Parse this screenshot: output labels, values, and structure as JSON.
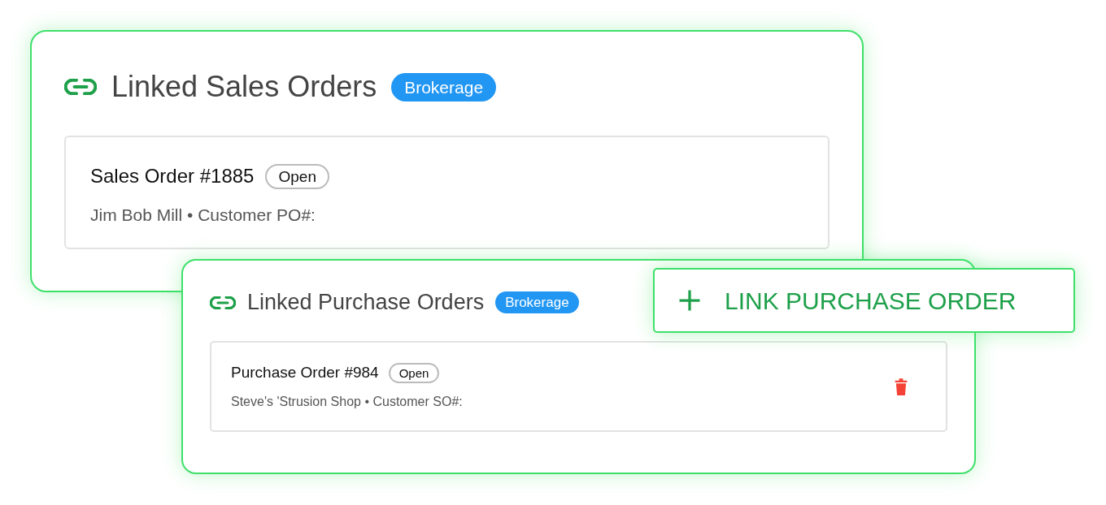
{
  "sales_panel": {
    "title": "Linked Sales Orders",
    "badge": "Brokerage",
    "orders": [
      {
        "title": "Sales Order #1885",
        "status": "Open",
        "subtitle": "Jim Bob Mill • Customer PO#:"
      }
    ]
  },
  "purchase_panel": {
    "title": "Linked Purchase Orders",
    "badge": "Brokerage",
    "orders": [
      {
        "title": "Purchase Order #984",
        "status": "Open",
        "subtitle": "Steve's 'Strusion Shop • Customer SO#:"
      }
    ]
  },
  "link_button": {
    "label": "LINK PURCHASE ORDER"
  }
}
